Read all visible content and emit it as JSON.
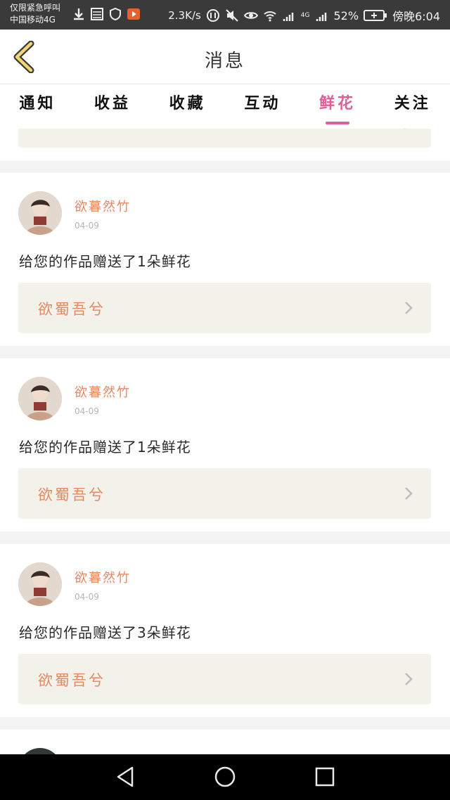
{
  "status_bar": {
    "carrier_line1": "仅限紧急呼叫",
    "carrier_line2": "中国移动4G",
    "speed": "2.3K/s",
    "network": "4G",
    "battery": "52%",
    "time": "傍晚6:04"
  },
  "header": {
    "title": "消息"
  },
  "tabs": [
    {
      "label": "通知"
    },
    {
      "label": "收益"
    },
    {
      "label": "收藏"
    },
    {
      "label": "互动"
    },
    {
      "label": "鲜花",
      "active": true
    },
    {
      "label": "关注"
    }
  ],
  "items": [
    {
      "name": "欲暮然竹",
      "date": "04-09",
      "message": "给您的作品赠送了1朵鲜花",
      "work": "欲蜀吾兮"
    },
    {
      "name": "欲暮然竹",
      "date": "04-09",
      "message": "给您的作品赠送了1朵鲜花",
      "work": "欲蜀吾兮"
    },
    {
      "name": "欲暮然竹",
      "date": "04-09",
      "message": "给您的作品赠送了3朵鲜花",
      "work": "欲蜀吾兮"
    }
  ],
  "colors": {
    "accent": "#e15d97",
    "name_color": "#e38a65",
    "work_bg": "#f3f2ea"
  }
}
